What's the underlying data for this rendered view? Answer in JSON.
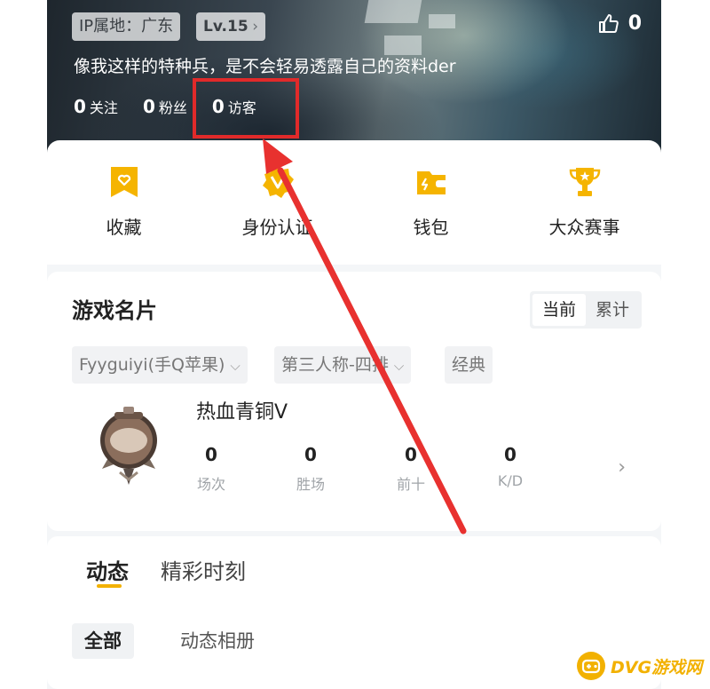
{
  "profile": {
    "ip_location": "IP属地：广东",
    "level": "Lv.15",
    "likes": "0",
    "bio": "像我这样的特种兵，是不会轻易透露自己的资料der",
    "stats": [
      {
        "num": "0",
        "label": "关注"
      },
      {
        "num": "0",
        "label": "粉丝"
      },
      {
        "num": "0",
        "label": "访客"
      }
    ]
  },
  "quick_entries": [
    {
      "label": "收藏",
      "icon": "bookmark-heart-icon"
    },
    {
      "label": "身份认证",
      "icon": "badge-v-icon"
    },
    {
      "label": "钱包",
      "icon": "wallet-icon"
    },
    {
      "label": "大众赛事",
      "icon": "trophy-icon"
    }
  ],
  "game_card": {
    "title": "游戏名片",
    "toggle": {
      "current": "当前",
      "total": "累计"
    },
    "filters": {
      "account": "Fyyguiyi(手Q苹果)",
      "mode": "第三人称-四排",
      "type": "经典"
    },
    "rank": "热血青铜V",
    "stats": [
      {
        "value": "0",
        "label": "场次"
      },
      {
        "value": "0",
        "label": "胜场"
      },
      {
        "value": "0",
        "label": "前十"
      },
      {
        "value": "0",
        "label": "K/D"
      }
    ]
  },
  "feed": {
    "tabs": [
      "动态",
      "精彩时刻"
    ],
    "sub_tabs": [
      "全部",
      "动态相册"
    ]
  },
  "watermark": {
    "text": "DVG游戏网"
  },
  "colors": {
    "accent": "#F2B100",
    "highlight_box": "#E12A2A",
    "arrow": "#E8312F"
  }
}
